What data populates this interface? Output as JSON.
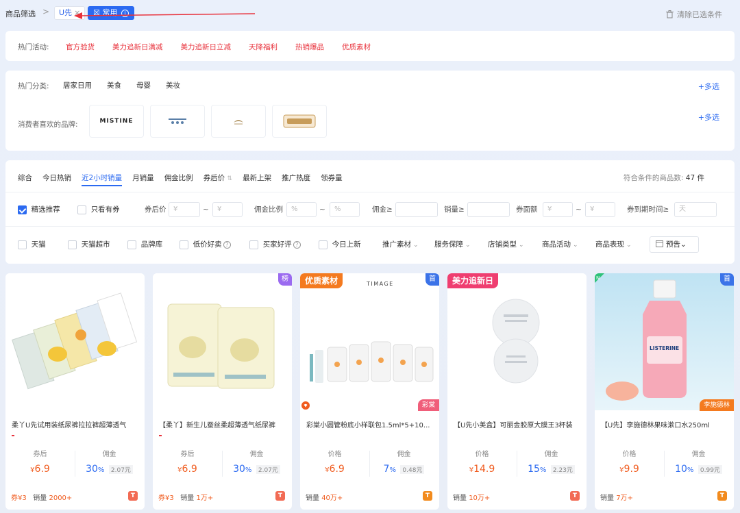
{
  "topbar": {
    "breadcrumb": "商品筛选",
    "breadcrumb_sep": ">",
    "chip_u": "U先",
    "chip_close": "×",
    "chip_common": "常用",
    "chip_common_prefix": "☒",
    "chip_common_info": "i",
    "clear": "清除已选条件",
    "trash_icon": "trash-icon"
  },
  "hot_activities": {
    "label": "热门活动:",
    "items": [
      "官方验货",
      "美力追新日满减",
      "美力追新日立减",
      "天降福利",
      "热销爆品",
      "优质素材"
    ]
  },
  "categories": {
    "label": "热门分类:",
    "items": [
      "居家日用",
      "美食",
      "母婴",
      "美妆"
    ],
    "multi": "+多选",
    "brands_label": "消费者喜欢的品牌:",
    "brands": [
      "MISTINE"
    ],
    "brands_multi": "+多选"
  },
  "filters": {
    "sorts": [
      "综合",
      "今日热销",
      "近2小时销量",
      "月销量",
      "佣金比例",
      "券后价",
      "最新上架",
      "推广热度",
      "领券量"
    ],
    "sort_icon": "⇅",
    "count_label": "符合条件的商品数:",
    "count_value": "47 件",
    "row2": {
      "featured": "精选推荐",
      "coupon_only": "只看有券",
      "after_coupon_price": "券后价",
      "commission_rate": "佣金比例",
      "commission": "佣金≥",
      "sales": "销量≥",
      "coupon_value": "券面额",
      "coupon_expire": "券到期时间≥",
      "yen_placeholder": "¥",
      "pct_placeholder": "%",
      "day_placeholder": "天",
      "tilde": "~"
    },
    "row3": {
      "checks": [
        "天猫",
        "天猫超市",
        "品牌库",
        "低价好卖",
        "买家好评",
        "今日上新"
      ],
      "dropdowns": [
        "推广素材",
        "服务保障",
        "店铺类型",
        "商品活动",
        "商品表现"
      ],
      "chevron": "⌄",
      "help": "?",
      "forecast": "预告"
    }
  },
  "products": [
    {
      "title": "柔丫U先试用装纸尿裤拉拉裤超薄透气",
      "l_label": "券后",
      "l_val": "6.9",
      "r_label": "佣金",
      "r_val": "30",
      "r_tag": "2.07元",
      "coupon": "券¥3",
      "sales_label": "销量",
      "sales": "2000+",
      "shop": "T"
    },
    {
      "title": "【柔丫】新生儿蚕丝柔超薄透气纸尿裤",
      "l_label": "券后",
      "l_val": "6.9",
      "r_label": "佣金",
      "r_val": "30",
      "r_tag": "2.07元",
      "coupon": "券¥3",
      "sales_label": "销量",
      "sales": "1万+",
      "shop": "T",
      "badge_tr": "榜"
    },
    {
      "title": "彩棠小圆管粉底小样联包1.5ml*5+10...",
      "l_label": "价格",
      "l_val": "6.9",
      "r_label": "佣金",
      "r_val": "7",
      "r_tag": "0.48元",
      "sales_label": "销量",
      "sales": "40万+",
      "shop": "T",
      "badge_tl": "优质素材",
      "badge_tr": "首",
      "badge_br": "彩棠",
      "img_text": "TIMAGE"
    },
    {
      "title": "【U先小美盒】可丽金胶原大膜王3杯装",
      "l_label": "价格",
      "l_val": "14.9",
      "r_label": "佣金",
      "r_val": "15",
      "r_tag": "2.23元",
      "sales_label": "销量",
      "sales": "10万+",
      "shop": "T",
      "badge_tl": "美力追新日"
    },
    {
      "title": "【U先】李施德林果味漱口水250ml",
      "l_label": "价格",
      "l_val": "9.9",
      "r_label": "佣金",
      "r_val": "10",
      "r_tag": "0.99元",
      "sales_label": "销量",
      "sales": "7万+",
      "shop": "T",
      "badge_tr": "首",
      "badge_br": "李施德林",
      "badge_n": "N",
      "img_text": "LISTERINE"
    }
  ],
  "currency": "¥",
  "percent": "%",
  "colors": {
    "accent": "#2b6af1",
    "price": "#f05b1e",
    "hot": "#e8323c",
    "orange_badge": "#f47a1f",
    "pink_badge": "#ef3e70",
    "purple_badge": "#9b6bf0",
    "blue_badge": "#3b73e8"
  }
}
